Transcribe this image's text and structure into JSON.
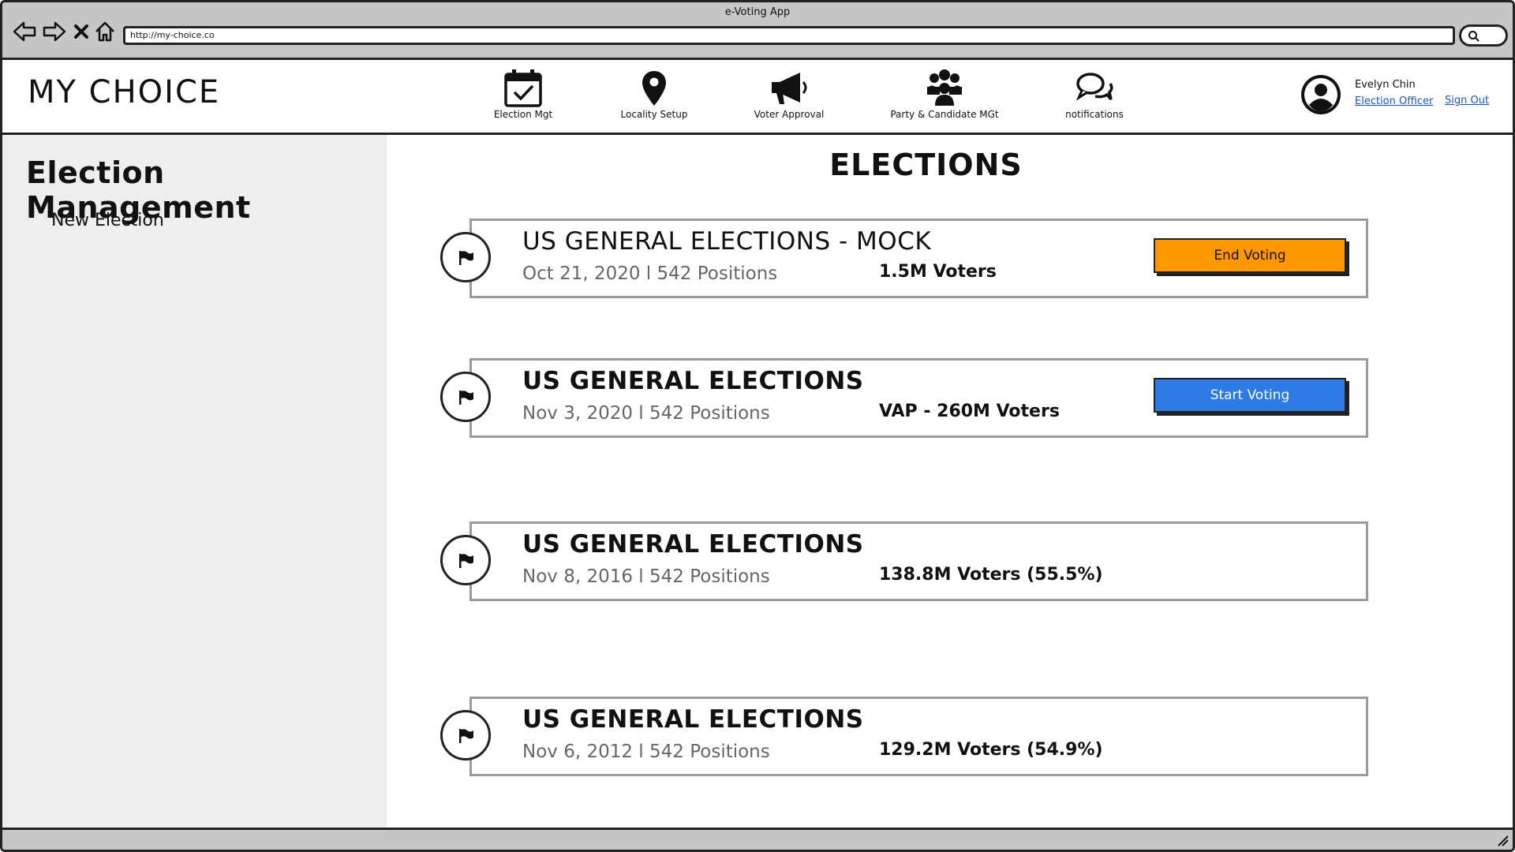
{
  "window": {
    "title": "e-Voting App",
    "url": "http://my-choice.co"
  },
  "app": {
    "brand": "MY CHOICE"
  },
  "nav": [
    {
      "label": "Election Mgt",
      "icon": "calendar-check-icon"
    },
    {
      "label": "Locality Setup",
      "icon": "map-pin-icon"
    },
    {
      "label": "Voter Approval",
      "icon": "megaphone-icon"
    },
    {
      "label": "Party & Candidate MGt",
      "icon": "users-group-icon"
    },
    {
      "label": "notifications",
      "icon": "chat-bubbles-icon"
    }
  ],
  "user": {
    "name": "Evelyn Chin",
    "role": "Election Officer",
    "sign_out": "Sign Out"
  },
  "sidebar": {
    "title": "Election Management",
    "new_election": "New Election"
  },
  "main": {
    "title": "ELECTIONS",
    "elections": [
      {
        "title": "US GENERAL ELECTIONS - MOCK",
        "subtitle": "Oct 21, 2020 l 542 Positions",
        "voters": "1.5M Voters",
        "action": "End Voting",
        "action_color": "#ff9800"
      },
      {
        "title": "US GENERAL ELECTIONS",
        "subtitle": "Nov 3, 2020 l 542 Positions",
        "voters": "VAP - 260M Voters",
        "action": "Start Voting",
        "action_color": "#2f7be6"
      },
      {
        "title": "US GENERAL ELECTIONS",
        "subtitle": "Nov 8, 2016 l 542 Positions",
        "voters": "138.8M Voters (55.5%)"
      },
      {
        "title": "US GENERAL ELECTIONS",
        "subtitle": "Nov 6, 2012 l 542 Positions",
        "voters": "129.2M Voters (54.9%)"
      }
    ]
  }
}
